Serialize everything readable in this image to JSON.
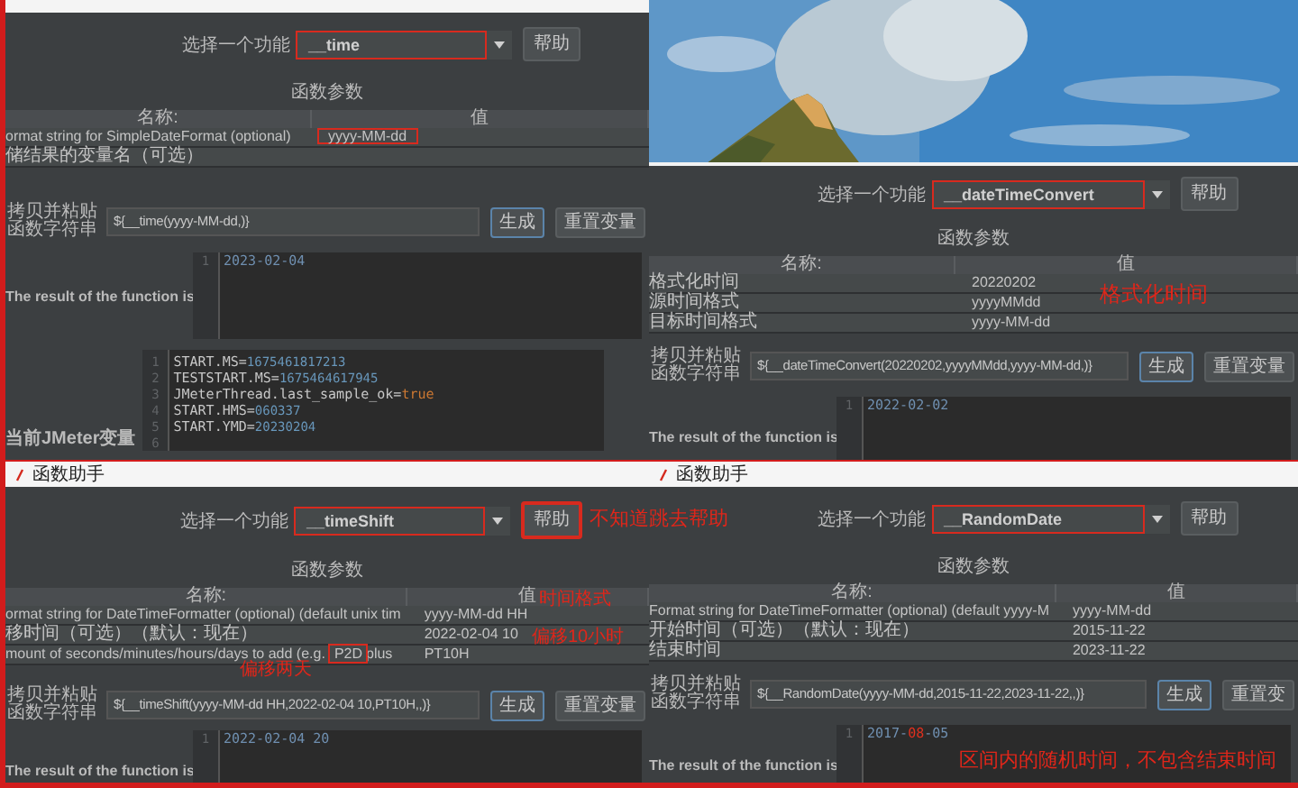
{
  "panels": [
    {
      "kind": "strip",
      "function_label": "选择一个功能",
      "function": "__time",
      "function_highlighted": true,
      "help": "帮助",
      "help_highlighted": false,
      "params_heading": "函数参数",
      "columns": [
        "名称:",
        "值"
      ],
      "rows": [
        {
          "name": "ormat string for SimpleDateFormat (optional)",
          "value": "yyyy-MM-dd",
          "highlighted": true
        },
        {
          "name": "储结果的变量名（可选）",
          "highlighted": false
        }
      ],
      "copy_label": "拷贝并粘贴函数字符串",
      "function_string": "${__time(yyyy-MM-dd,)}",
      "generate": "生成",
      "reset": "重置变量",
      "result_label": "The result of the function is",
      "result_lines": [
        {
          "number": "1",
          "segments": [
            {
              "text": "2023-02-04",
              "kind": "plain"
            }
          ]
        }
      ],
      "variables_label": "当前JMeter变量",
      "variables": [
        {
          "number": "1",
          "key": "START.MS=",
          "value": "1675461817213",
          "kind": "number"
        },
        {
          "number": "2",
          "key": "TESTSTART.MS=",
          "value": "1675464617945",
          "kind": "number"
        },
        {
          "number": "3",
          "key": "JMeterThread.last_sample_ok=",
          "value": "true",
          "kind": "boolean"
        },
        {
          "number": "4",
          "key": "START.HMS=",
          "value": "060337",
          "kind": "number"
        },
        {
          "number": "5",
          "key": "START.YMD=",
          "value": "20230204",
          "kind": "number"
        },
        {
          "number": "6",
          "kind": "empty"
        }
      ]
    },
    {
      "kind": "picture",
      "function_label": "选择一个功能",
      "function": "__dateTimeConvert",
      "function_highlighted": true,
      "help": "帮助",
      "help_highlighted": false,
      "params_heading": "函数参数",
      "columns": [
        "名称:",
        "值"
      ],
      "rows": [
        {
          "name": "格式化时间",
          "value": "20220202",
          "highlighted": false
        },
        {
          "name": "源时间格式",
          "value": "yyyyMMdd",
          "highlighted": false
        },
        {
          "name": "目标时间格式",
          "value": "yyyy-MM-dd",
          "highlighted": false
        }
      ],
      "copy_label": "拷贝并粘贴函数字符串",
      "function_string": "${__dateTimeConvert(20220202,yyyyMMdd,yyyy-MM-dd,)}",
      "generate": "生成",
      "reset": "重置变量",
      "result_label": "The result of the function is",
      "result_lines": [
        {
          "number": "1",
          "segments": [
            {
              "text": "2022-02-02",
              "kind": "plain"
            }
          ]
        }
      ],
      "notes": [
        "格式化时间"
      ]
    },
    {
      "kind": "titled",
      "title": "函数助手",
      "function_label": "选择一个功能",
      "function": "__timeShift",
      "function_highlighted": true,
      "help": "帮助",
      "help_highlighted": true,
      "params_heading": "函数参数",
      "columns": [
        "名称:",
        "值"
      ],
      "rows": [
        {
          "name": "ormat string for DateTimeFormatter (optional) (default unix tim",
          "value": "yyyy-MM-dd HH",
          "highlighted": false
        },
        {
          "name": "移时间（可选）（默认：现在）",
          "value": "2022-02-04 10",
          "highlighted": false
        },
        {
          "name": "mount of seconds/minutes/hours/days to add (e.g.",
          "boxed": "P2D",
          "name_rest": "plus",
          "value": "PT10H",
          "highlighted": false
        }
      ],
      "copy_label": "拷贝并粘贴函数字符串",
      "function_string": "${__timeShift(yyyy-MM-dd HH,2022-02-04 10,PT10H,,)}",
      "generate": "生成",
      "reset": "重置变量",
      "result_label": "The result of the function is",
      "result_lines": [
        {
          "number": "1",
          "segments": [
            {
              "text": "2022-02-04 20",
              "kind": "plain"
            }
          ]
        }
      ],
      "notes": [
        "时间格式",
        "偏移10小时",
        "偏移两天"
      ]
    },
    {
      "kind": "titled",
      "title": "函数助手",
      "function_label": "选择一个功能",
      "function": "__RandomDate",
      "function_highlighted": true,
      "help": "帮助",
      "help_highlighted": false,
      "params_heading": "函数参数",
      "columns": [
        "名称:",
        "值"
      ],
      "rows": [
        {
          "name": "Format string for DateTimeFormatter (optional) (default yyyy-M",
          "value": "yyyy-MM-dd",
          "highlighted": false
        },
        {
          "name": "开始时间（可选）（默认：现在）",
          "value": "2015-11-22",
          "highlighted": false
        },
        {
          "name": "结束时间",
          "value": "2023-11-22",
          "highlighted": false
        }
      ],
      "copy_label": "拷贝并粘贴函数字符串",
      "function_string": "${__RandomDate(yyyy-MM-dd,2015-11-22,2023-11-22,,)}",
      "generate": "生成",
      "reset": "重置变",
      "result_label": "The result of the function is",
      "result_lines": [
        {
          "number": "1",
          "segments": [
            {
              "text": "2017-",
              "kind": "plain"
            },
            {
              "text": "08",
              "kind": "marked"
            },
            {
              "text": "-05",
              "kind": "plain"
            }
          ]
        }
      ],
      "notes": [
        "区间内的随机时间，不包含结束时间"
      ]
    }
  ],
  "overlay_notes": [
    "不知道跳去帮助"
  ]
}
